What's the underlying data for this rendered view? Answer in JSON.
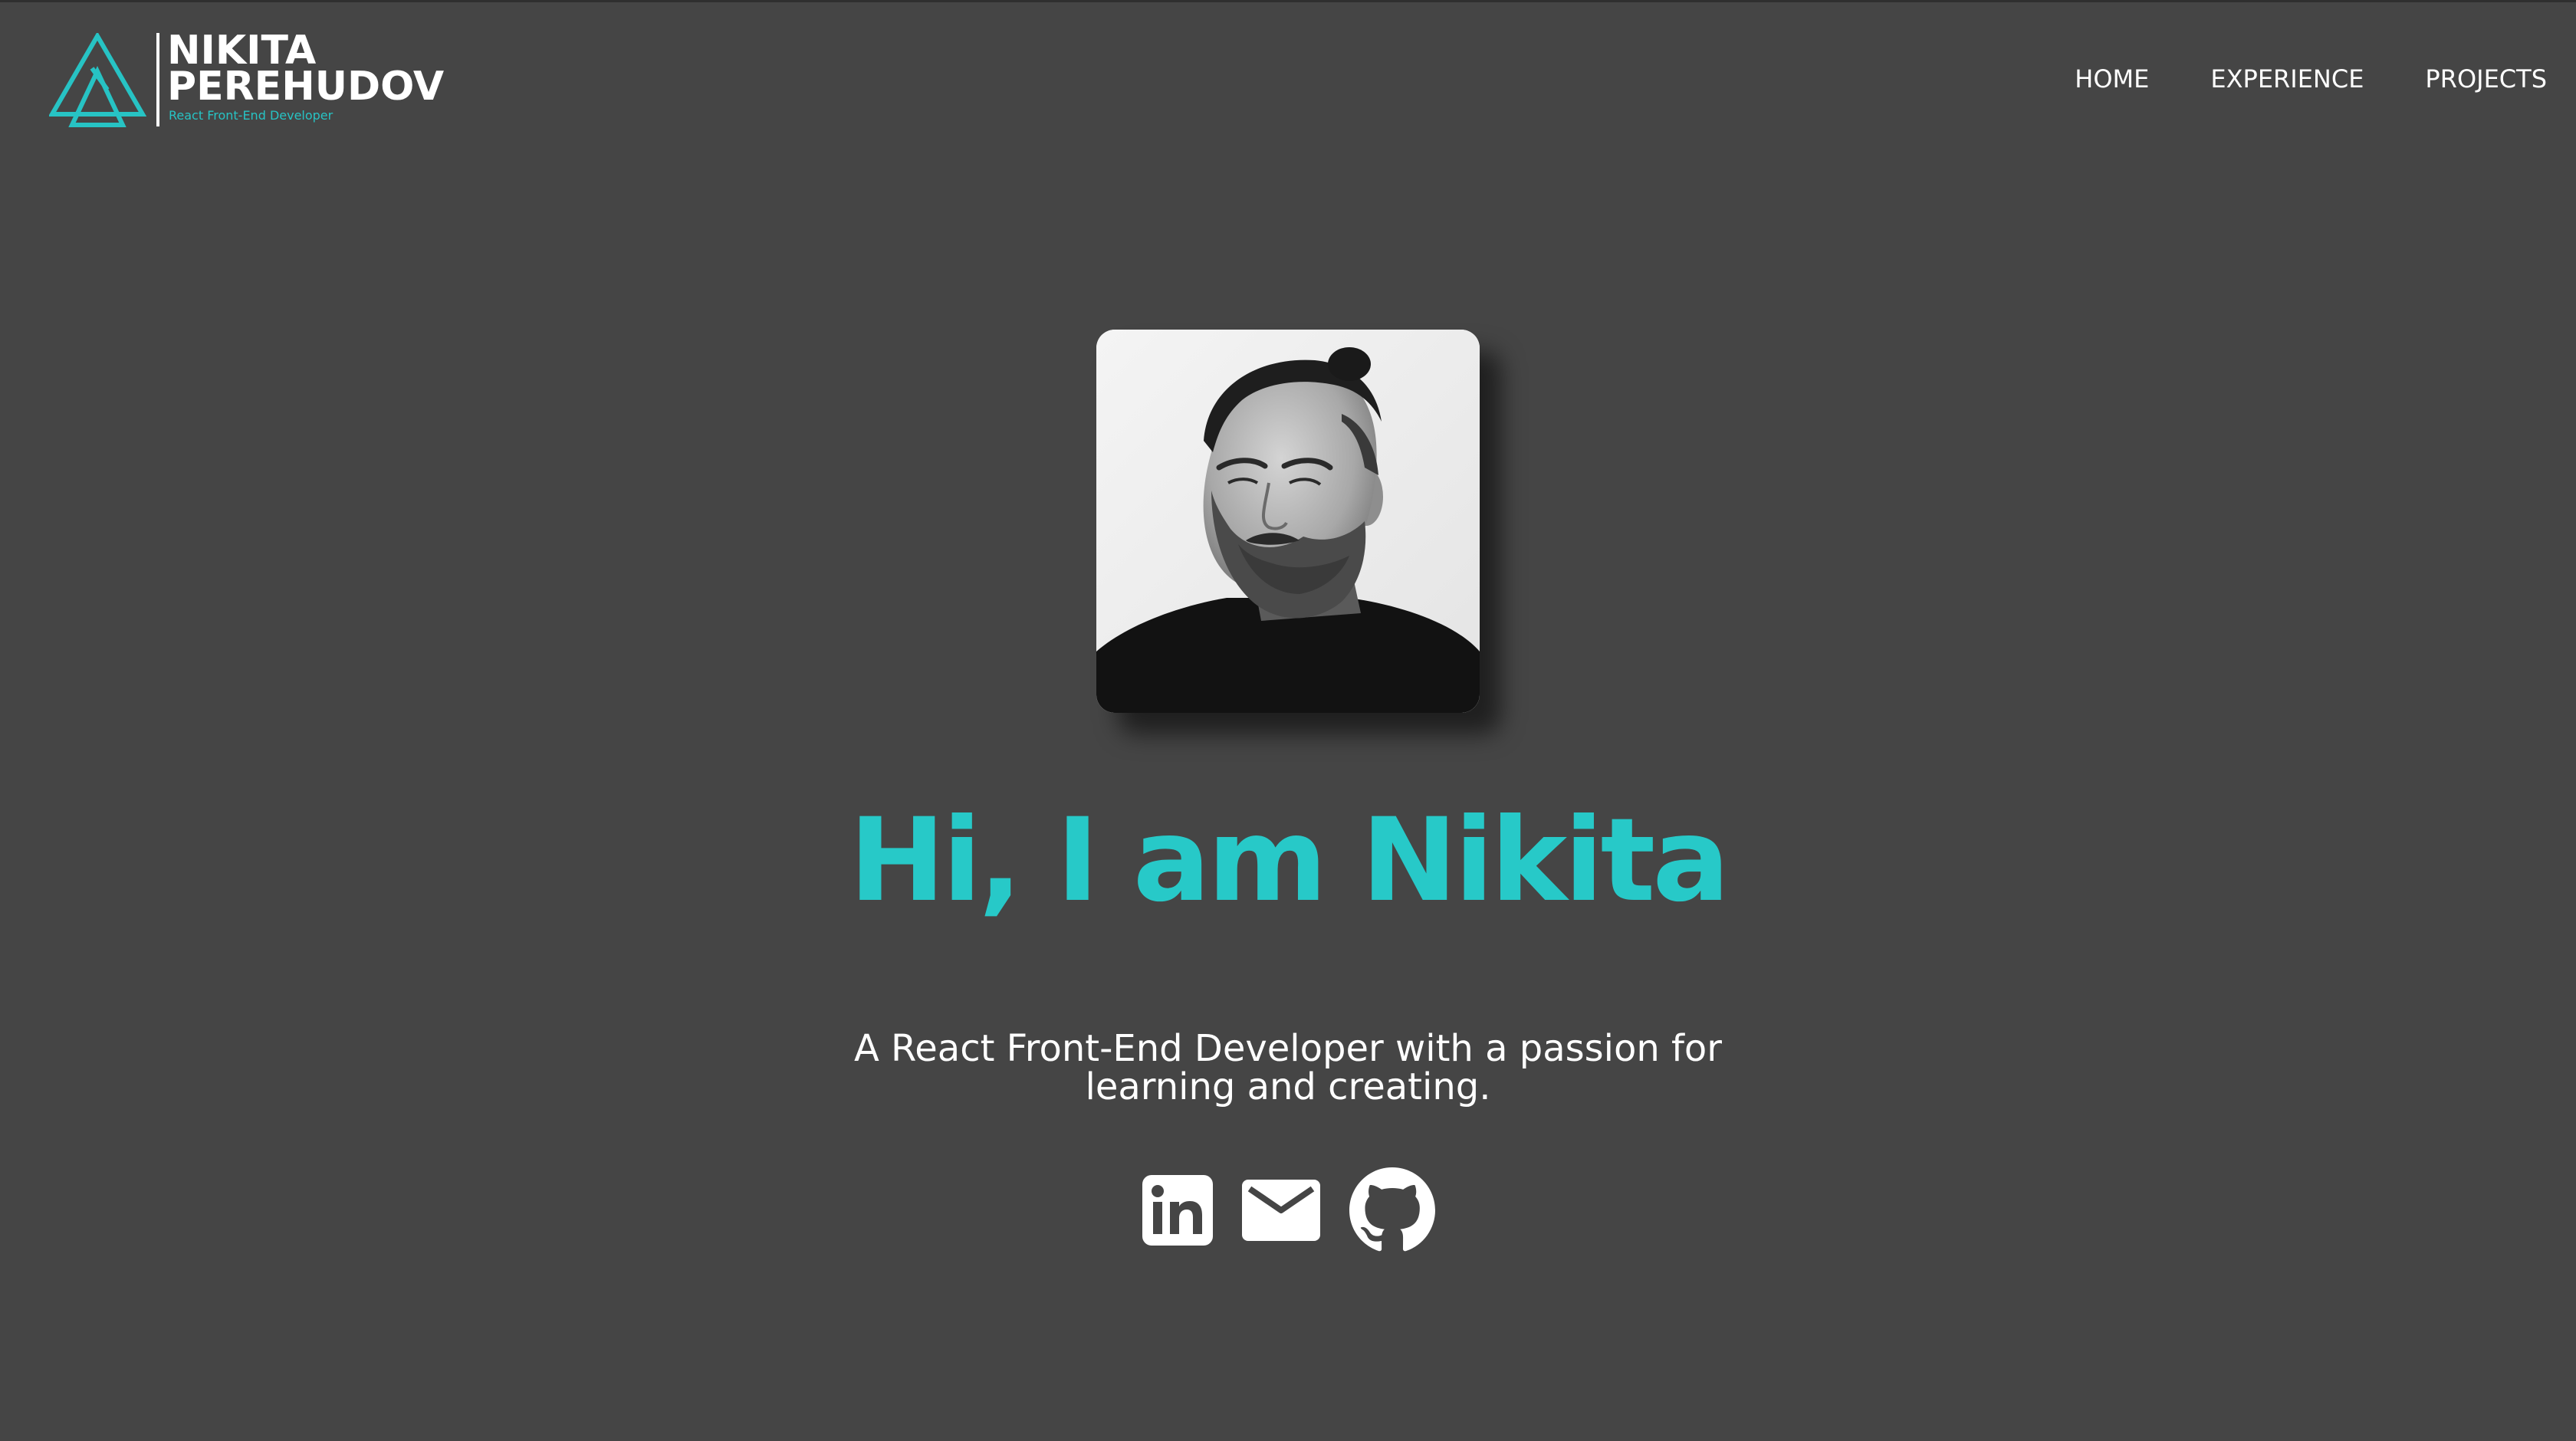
{
  "brand": {
    "name_line1": "NIKITA",
    "name_line2": "PEREHUDOV",
    "tagline": "React Front-End Developer",
    "accent_color": "#27c9c8"
  },
  "nav": {
    "items": [
      {
        "label": "HOME"
      },
      {
        "label": "EXPERIENCE"
      },
      {
        "label": "PROJECTS"
      }
    ]
  },
  "hero": {
    "title": "Hi, I am Nikita",
    "subtitle": "A React Front-End Developer with a passion for learning and creating.",
    "avatar_icon": "profile-photo"
  },
  "social": {
    "items": [
      {
        "icon": "linkedin-icon"
      },
      {
        "icon": "email-icon"
      },
      {
        "icon": "github-icon"
      }
    ]
  },
  "colors": {
    "background": "#454545",
    "text": "#ffffff",
    "accent": "#27c9c8"
  }
}
